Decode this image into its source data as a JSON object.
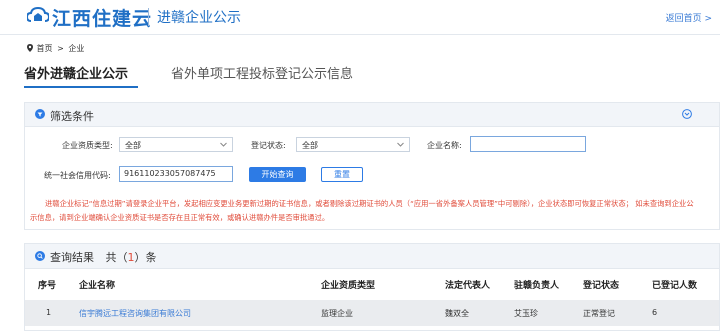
{
  "header": {
    "logo_text": "江西住建云",
    "subtitle": "进赣企业公示",
    "back_home": "返回首页 >"
  },
  "breadcrumb": {
    "home": "首页",
    "separator": ">",
    "current": "企业"
  },
  "tabs": [
    {
      "label": "省外进赣企业公示",
      "active": true
    },
    {
      "label": "省外单项工程投标登记公示信息",
      "active": false
    }
  ],
  "filter": {
    "title": "筛选条件",
    "qualification_label": "企业资质类型:",
    "qualification_value": "全部",
    "status_label": "登记状态:",
    "status_value": "全部",
    "company_name_label": "企业名称:",
    "company_name_value": "",
    "credit_code_label": "统一社会信用代码:",
    "credit_code_value": "91611023305708747​5",
    "search_button": "开始查询",
    "reset_button": "重置",
    "notice": "进赣企业标记“信息过期”请登录企业平台，发起相应变更业务更新过期的证书信息，或者剔除该过期证书的人员（“应用一省外备案人员管理”中可剔除），企业状态即可恢复正常状态； 如未查询到企业公示信息，请到企业端确认企业资质证书是否存在且正常有效，或确认进赣办件是否审批通过。"
  },
  "results": {
    "title": "查询结果",
    "count_prefix": "共（",
    "count": "1",
    "count_suffix": "）条",
    "columns": [
      "序号",
      "企业名称",
      "企业资质类型",
      "法定代表人",
      "驻赣负责人",
      "登记状态",
      "已登记人数"
    ],
    "rows": [
      {
        "index": "1",
        "company": "信宇腾远工程咨询集团有限公司",
        "qualification": "监理企业",
        "legal_rep": "魏双全",
        "local_rep": "艾玉珍",
        "status": "正常登记",
        "registered": "6"
      }
    ]
  },
  "colors": {
    "brand": "#1f6fc5",
    "primary_button": "#2d7be5",
    "notice_red": "#e04b3a",
    "panel_header": "#f2f5f9"
  }
}
